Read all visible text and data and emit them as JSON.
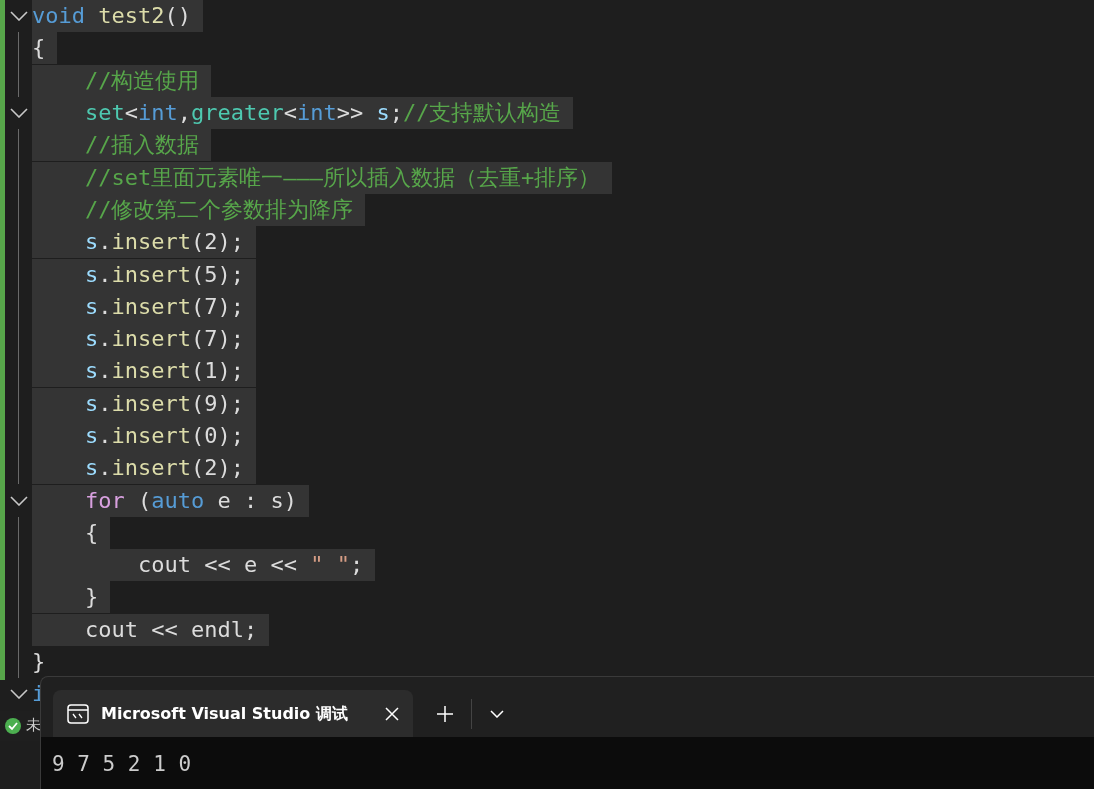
{
  "editor": {
    "lines": [
      {
        "fold": true,
        "selected": true,
        "tokens": [
          {
            "kind": "keyword",
            "text": "void "
          },
          {
            "kind": "function",
            "text": "test2"
          },
          {
            "kind": "plain",
            "text": "()"
          }
        ]
      },
      {
        "fold": false,
        "selected": true,
        "tokens": [
          {
            "kind": "plain",
            "text": "{"
          }
        ]
      },
      {
        "fold": false,
        "selected": true,
        "tokens": [
          {
            "kind": "comment",
            "text": "    //构造使用"
          }
        ]
      },
      {
        "fold": true,
        "selected": true,
        "tokens": [
          {
            "kind": "type",
            "text": "    set"
          },
          {
            "kind": "plain",
            "text": "<"
          },
          {
            "kind": "keyword",
            "text": "int"
          },
          {
            "kind": "plain",
            "text": ","
          },
          {
            "kind": "type",
            "text": "greater"
          },
          {
            "kind": "plain",
            "text": "<"
          },
          {
            "kind": "keyword",
            "text": "int"
          },
          {
            "kind": "plain",
            "text": ">> "
          },
          {
            "kind": "variable",
            "text": "s"
          },
          {
            "kind": "plain",
            "text": ";"
          },
          {
            "kind": "comment",
            "text": "//支持默认构造"
          }
        ]
      },
      {
        "fold": false,
        "selected": true,
        "tokens": [
          {
            "kind": "comment",
            "text": "    //插入数据"
          }
        ]
      },
      {
        "fold": false,
        "selected": true,
        "tokens": [
          {
            "kind": "comment",
            "text": "    //set里面元素唯一———所以插入数据（去重+排序）"
          }
        ]
      },
      {
        "fold": false,
        "selected": true,
        "tokens": [
          {
            "kind": "comment",
            "text": "    //修改第二个参数排为降序"
          }
        ]
      },
      {
        "fold": false,
        "selected": true,
        "tokens": [
          {
            "kind": "variable",
            "text": "    s"
          },
          {
            "kind": "plain",
            "text": "."
          },
          {
            "kind": "function",
            "text": "insert"
          },
          {
            "kind": "plain",
            "text": "(2);"
          }
        ]
      },
      {
        "fold": false,
        "selected": true,
        "tokens": [
          {
            "kind": "variable",
            "text": "    s"
          },
          {
            "kind": "plain",
            "text": "."
          },
          {
            "kind": "function",
            "text": "insert"
          },
          {
            "kind": "plain",
            "text": "(5);"
          }
        ]
      },
      {
        "fold": false,
        "selected": true,
        "tokens": [
          {
            "kind": "variable",
            "text": "    s"
          },
          {
            "kind": "plain",
            "text": "."
          },
          {
            "kind": "function",
            "text": "insert"
          },
          {
            "kind": "plain",
            "text": "(7);"
          }
        ]
      },
      {
        "fold": false,
        "selected": true,
        "tokens": [
          {
            "kind": "variable",
            "text": "    s"
          },
          {
            "kind": "plain",
            "text": "."
          },
          {
            "kind": "function",
            "text": "insert"
          },
          {
            "kind": "plain",
            "text": "(7);"
          }
        ]
      },
      {
        "fold": false,
        "selected": true,
        "tokens": [
          {
            "kind": "variable",
            "text": "    s"
          },
          {
            "kind": "plain",
            "text": "."
          },
          {
            "kind": "function",
            "text": "insert"
          },
          {
            "kind": "plain",
            "text": "(1);"
          }
        ]
      },
      {
        "fold": false,
        "selected": true,
        "tokens": [
          {
            "kind": "variable",
            "text": "    s"
          },
          {
            "kind": "plain",
            "text": "."
          },
          {
            "kind": "function",
            "text": "insert"
          },
          {
            "kind": "plain",
            "text": "(9);"
          }
        ]
      },
      {
        "fold": false,
        "selected": true,
        "tokens": [
          {
            "kind": "variable",
            "text": "    s"
          },
          {
            "kind": "plain",
            "text": "."
          },
          {
            "kind": "function",
            "text": "insert"
          },
          {
            "kind": "plain",
            "text": "(0);"
          }
        ]
      },
      {
        "fold": false,
        "selected": true,
        "tokens": [
          {
            "kind": "variable",
            "text": "    s"
          },
          {
            "kind": "plain",
            "text": "."
          },
          {
            "kind": "function",
            "text": "insert"
          },
          {
            "kind": "plain",
            "text": "(2);"
          }
        ]
      },
      {
        "fold": true,
        "selected": true,
        "tokens": [
          {
            "kind": "control",
            "text": "    for"
          },
          {
            "kind": "plain",
            "text": " ("
          },
          {
            "kind": "keyword",
            "text": "auto"
          },
          {
            "kind": "plain",
            "text": " e : s)"
          }
        ]
      },
      {
        "fold": false,
        "selected": true,
        "tokens": [
          {
            "kind": "plain",
            "text": "    {"
          }
        ]
      },
      {
        "fold": false,
        "selected": true,
        "tokens": [
          {
            "kind": "plain",
            "text": "        cout << e << "
          },
          {
            "kind": "string",
            "text": "\" \""
          },
          {
            "kind": "plain",
            "text": ";"
          }
        ]
      },
      {
        "fold": false,
        "selected": true,
        "tokens": [
          {
            "kind": "plain",
            "text": "    }"
          }
        ]
      },
      {
        "fold": false,
        "selected": true,
        "tokens": [
          {
            "kind": "plain",
            "text": "    cout << endl;"
          }
        ]
      },
      {
        "fold": false,
        "selected": false,
        "tokens": [
          {
            "kind": "plain",
            "text": "}"
          }
        ]
      },
      {
        "fold": true,
        "selected": false,
        "tokens": [
          {
            "kind": "keyword",
            "text": "i"
          }
        ]
      }
    ]
  },
  "status_bar": {
    "text": "未"
  },
  "terminal": {
    "tab": {
      "title": "Microsoft Visual Studio 调试"
    },
    "output": "9 7 5 2 1 0"
  }
}
